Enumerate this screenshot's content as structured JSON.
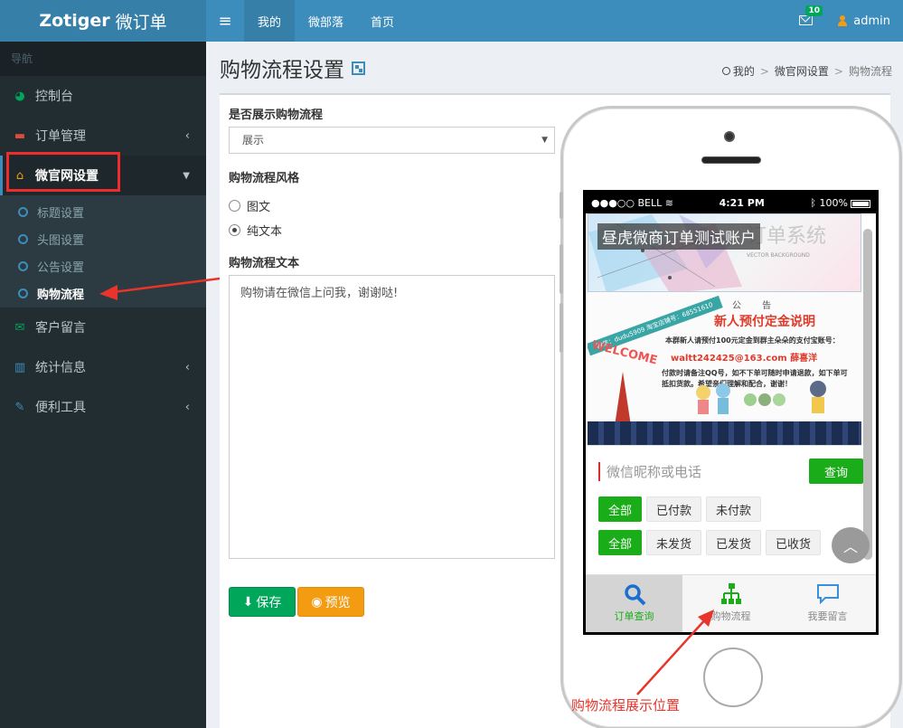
{
  "header": {
    "logo_brand": "Zotiger",
    "logo_sub": "微订单",
    "nav": [
      "我的",
      "微部落",
      "首页"
    ],
    "mail_badge": "10",
    "user": "admin"
  },
  "sidebar": {
    "header": "导航",
    "items": [
      {
        "label": "控制台",
        "icon": "dashboard-icon"
      },
      {
        "label": "订单管理",
        "icon": "cart-icon"
      },
      {
        "label": "微官网设置",
        "icon": "home-icon"
      },
      {
        "label": "客户留言",
        "icon": "envelope-icon"
      },
      {
        "label": "统计信息",
        "icon": "bar-chart-icon"
      },
      {
        "label": "便利工具",
        "icon": "wrench-icon"
      }
    ],
    "subitems": [
      "标题设置",
      "头图设置",
      "公告设置",
      "购物流程"
    ]
  },
  "page": {
    "title": "购物流程设置",
    "breadcrumb": [
      "我的",
      "微官网设置",
      "购物流程"
    ]
  },
  "form": {
    "show_label": "是否展示购物流程",
    "show_value": "展示",
    "style_label": "购物流程风格",
    "style_options": [
      "图文",
      "纯文本"
    ],
    "style_selected": "纯文本",
    "text_label": "购物流程文本",
    "text_value": "购物请在微信上问我，谢谢哒!",
    "save_label": "保存",
    "preview_label": "预览"
  },
  "phone": {
    "carrier": "●●●○○ BELL",
    "time": "4:21 PM",
    "battery": "100%",
    "banner_title": "昼虎微商订单测试账户",
    "banner_ghost": "订单系统",
    "banner_sub": "VECTOR BACKGROUND",
    "notice_tag": "微信：dudu5909  淘宝店铺号：68551610",
    "notice_title": "公  告",
    "notice_headline": "新人预付定金说明",
    "notice_line1": "本群新人请预付100元定金到群主朵朵的支付宝账号：",
    "notice_email": "waltt242425@163.com  薛喜洋",
    "notice_line2": "付款时请备注QQ号，如不下单可随时申请退款，如下单可抵扣货款。希望亲们理解和配合，谢谢！",
    "welcome": "WELCOME",
    "search_placeholder": "微信昵称或电话",
    "search_button": "查询",
    "filter_pay": [
      "全部",
      "已付款",
      "未付款"
    ],
    "filter_ship": [
      "全部",
      "未发货",
      "已发货",
      "已收货"
    ],
    "tabs": [
      "订单查询",
      "购物流程",
      "我要留言"
    ]
  },
  "annotation": {
    "label": "购物流程展示位置",
    "color": "#e8342a"
  }
}
